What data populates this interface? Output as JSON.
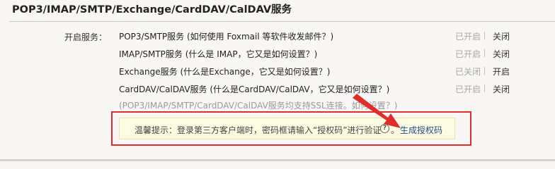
{
  "section": {
    "title": "POP3/IMAP/SMTP/Exchange/CardDAV/CalDAV服务"
  },
  "services": {
    "label": "开启服务：",
    "items": [
      {
        "name": "POP3/SMTP服务 (如何使用 Foxmail 等软件收发邮件？)",
        "status": "已开启",
        "action": "关闭"
      },
      {
        "name": "IMAP/SMTP服务 (什么是 IMAP，它又是如何设置？)",
        "status": "已开启",
        "action": "关闭"
      },
      {
        "name": "Exchange服务 (什么是Exchange，它又是如何设置？)",
        "status": "已关闭",
        "action": "开启"
      },
      {
        "name": "CardDAV/CalDAV服务 (什么是CardDAV/CalDAV，它又是如何设置？)",
        "status": "已开启",
        "action": "关闭"
      }
    ],
    "ssl_note": "(POP3/IMAP/SMTP/CardDAV/CalDAV服务均支持SSL连接。如何设置？)"
  },
  "tip": {
    "text": "温馨提示：登录第三方客户端时，密码框请输入“授权码”进行验证",
    "help_icon_glyph": "?",
    "separator": "。",
    "link": "生成授权码"
  },
  "colors": {
    "highlight_frame": "#e22b2b",
    "arrow": "#e22b2b",
    "tip_background": "#fdfbe1",
    "link": "#1d4f8c"
  }
}
